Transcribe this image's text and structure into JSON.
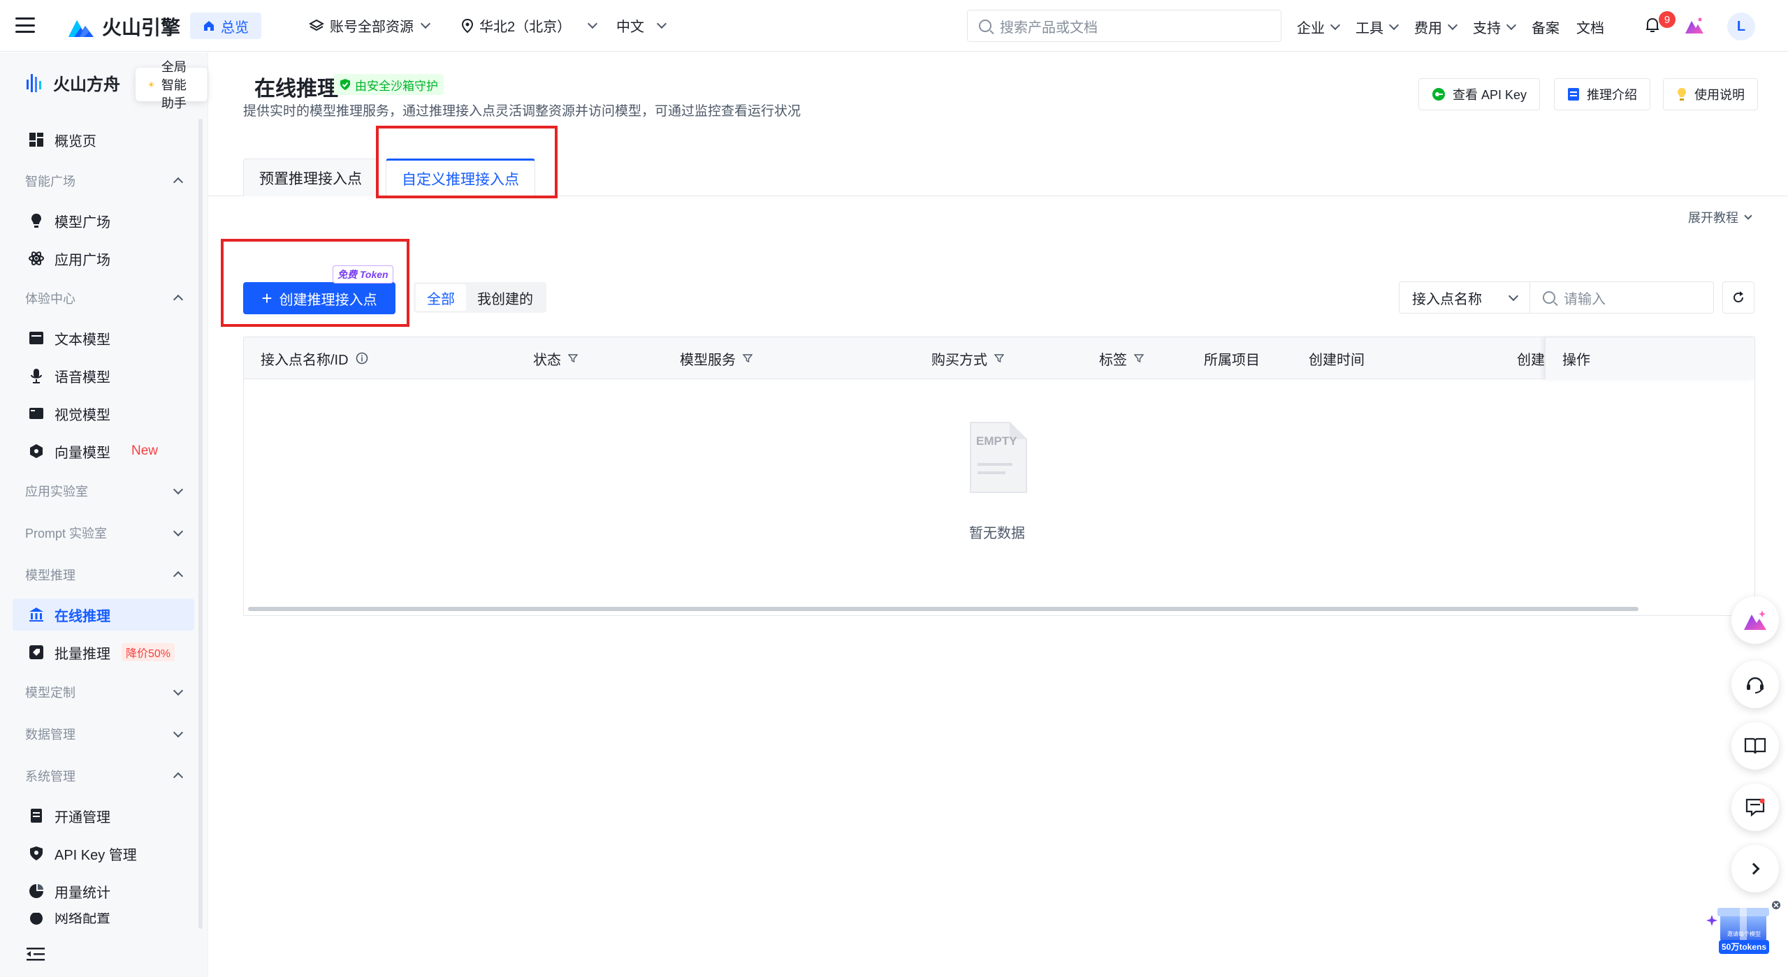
{
  "topbar": {
    "brand": "火山引擎",
    "overview_tab": "总览",
    "account_resources": "账号全部资源",
    "region": "华北2（北京）",
    "language": "中文",
    "search_placeholder": "搜索产品或文档",
    "nav": [
      {
        "label": "企业",
        "dropdown": true
      },
      {
        "label": "工具",
        "dropdown": true
      },
      {
        "label": "费用",
        "dropdown": true
      },
      {
        "label": "支持",
        "dropdown": true
      },
      {
        "label": "备案",
        "dropdown": false
      },
      {
        "label": "文档",
        "dropdown": false
      }
    ],
    "notification_count": "9",
    "avatar_initial": "L"
  },
  "sidebar": {
    "brand": "火山方舟",
    "assistant_popup": "全局智能助手",
    "overview": "概览页",
    "groups": {
      "smart_square": "智能广场",
      "experience": "体验中心",
      "app_lab": "应用实验室",
      "prompt_lab": "Prompt 实验室",
      "inference": "模型推理",
      "customize": "模型定制",
      "data_mgmt": "数据管理",
      "system_mgmt": "系统管理"
    },
    "items": {
      "model_square": "模型广场",
      "app_square": "应用广场",
      "text_model": "文本模型",
      "voice_model": "语音模型",
      "vision_model": "视觉模型",
      "vector_model": "向量模型",
      "vector_tag": "New",
      "online_inference": "在线推理",
      "batch_inference": "批量推理",
      "batch_tag": "降价50%",
      "activation": "开通管理",
      "api_key_mgmt": "API Key 管理",
      "usage_stats": "用量统计",
      "network": "网络配置"
    }
  },
  "main": {
    "title": "在线推理",
    "sandbox_badge": "由安全沙箱守护",
    "description": "提供实时的模型推理服务，通过推理接入点灵活调整资源并访问模型，可通过监控查看运行状况",
    "header_buttons": {
      "api_key": "查看 API Key",
      "intro": "推理介绍",
      "guide": "使用说明"
    },
    "tabs": [
      {
        "label": "预置推理接入点",
        "active": false
      },
      {
        "label": "自定义推理接入点",
        "active": true
      }
    ],
    "tutorial": "展开教程",
    "create_button": "创建推理接入点",
    "free_token_badge": "免费 Token",
    "segment": {
      "all": "全部",
      "mine": "我创建的"
    },
    "filter": {
      "field": "接入点名称",
      "placeholder": "请输入"
    },
    "table": {
      "columns": [
        {
          "label": "接入点名称/ID",
          "info": true,
          "filter": false
        },
        {
          "label": "状态",
          "filter": true
        },
        {
          "label": "模型服务",
          "filter": true
        },
        {
          "label": "购买方式",
          "filter": true
        },
        {
          "label": "标签",
          "filter": true
        },
        {
          "label": "所属项目",
          "filter": false
        },
        {
          "label": "创建时间",
          "filter": false
        },
        {
          "label": "创建",
          "filter": false
        },
        {
          "label": "操作",
          "filter": false
        }
      ],
      "empty_image_text": "EMPTY",
      "empty_text": "暂无数据"
    }
  },
  "floating": {
    "promo_line1": "邀请每个模型",
    "promo_line2": "50万tokens"
  },
  "colors": {
    "primary": "#165dff",
    "highlight_box": "#e62424",
    "danger": "#f53f3f",
    "success": "#00b42a"
  }
}
